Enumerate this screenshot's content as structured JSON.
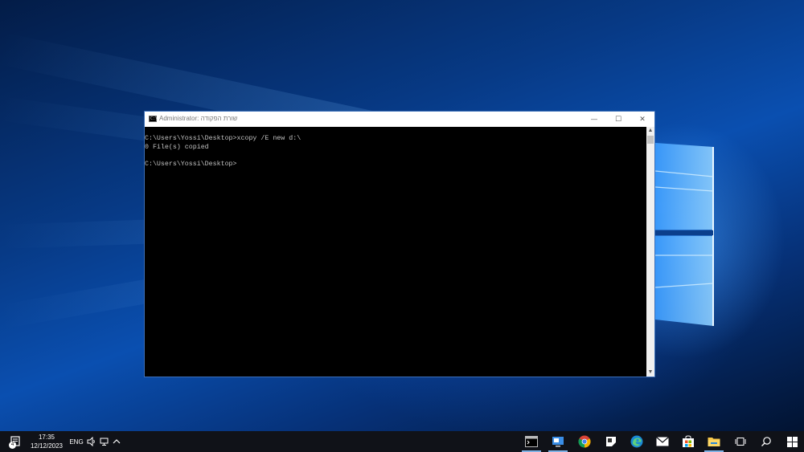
{
  "window": {
    "title": "Administrator: שורת הפקודה",
    "minimize_glyph": "—",
    "maximize_glyph": "☐",
    "close_glyph": "✕"
  },
  "console": {
    "lines": [
      "C:\\Users\\Yossi\\Desktop>xcopy /E new d:\\",
      "0 File(s) copied",
      "",
      "C:\\Users\\Yossi\\Desktop>"
    ]
  },
  "scrollbar": {
    "up_glyph": "▲",
    "down_glyph": "▼"
  },
  "taskbar": {
    "notification_count": "4",
    "time": "17:35",
    "date": "12/12/2023",
    "language": "ENG",
    "icons": {
      "notification": "notification-center-icon",
      "volume": "volume-icon",
      "network": "network-icon",
      "show_hidden": "chevron-up-icon",
      "apps": [
        "command-prompt-icon",
        "remote-desktop-icon",
        "chrome-icon",
        "sticky-notes-icon",
        "edge-icon",
        "mail-icon",
        "store-icon",
        "file-explorer-icon",
        "task-view-icon",
        "search-icon",
        "start-icon"
      ]
    }
  },
  "colors": {
    "console_bg": "#000000",
    "console_text": "#c0c0c0",
    "taskbar_bg": "#101218",
    "active_indicator": "#7fb2e5"
  }
}
